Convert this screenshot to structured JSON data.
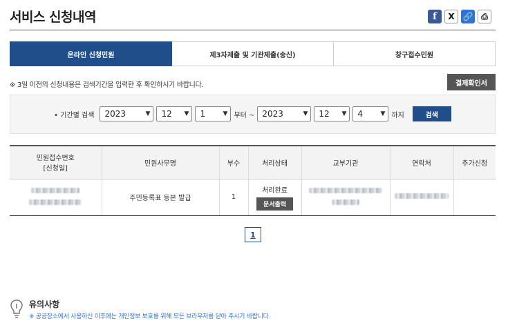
{
  "page": {
    "title": "서비스 신청내역"
  },
  "share": {
    "facebook": "f",
    "x": "X",
    "link": "🔗",
    "print": "⎙"
  },
  "tabs": [
    {
      "label": "온라인 신청민원"
    },
    {
      "label": "제3자제출 및 기관제출(송신)"
    },
    {
      "label": "창구접수민원"
    }
  ],
  "notice": "※ 3일 이전의 신청내용은 검색기간을 입력한 후 확인하시기 바랍니다.",
  "payment_button": "결제확인서",
  "search": {
    "label": "• 기간별 검색",
    "from": {
      "year": "2023",
      "month": "12",
      "day": "1"
    },
    "from_suffix": "부터 ~",
    "to": {
      "year": "2023",
      "month": "12",
      "day": "4"
    },
    "to_suffix": "까지",
    "button": "검색"
  },
  "table": {
    "headers": [
      "민원접수번호",
      "[신청일]",
      "민원사무명",
      "부수",
      "처리상태",
      "교부기관",
      "연락처",
      "추가신청"
    ],
    "rows": [
      {
        "name": "주민등록표 등본 발급",
        "copies": "1",
        "status": "처리완료",
        "print_button": "문서출력"
      }
    ]
  },
  "pagination": {
    "current": "1"
  },
  "caution": {
    "title": "유의사항",
    "text": "※ 공공장소에서 사용하신 이후에는 개인정보 보호를 위해 모든 브라우저를 닫아 주시기 바랍니다."
  }
}
